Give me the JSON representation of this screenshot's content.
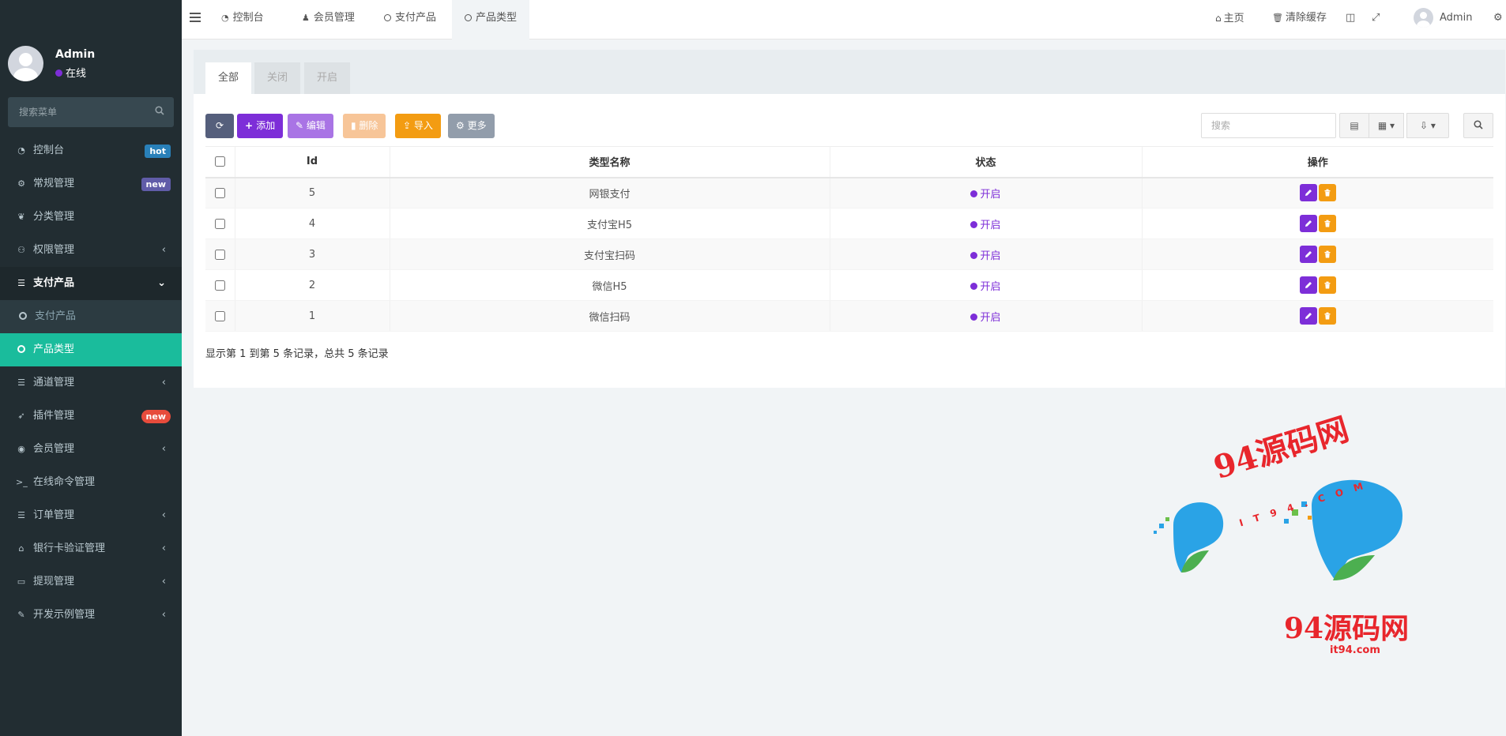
{
  "user": {
    "name": "Admin",
    "status": "在线"
  },
  "sidebar": {
    "search_placeholder": "搜索菜单",
    "items": [
      {
        "label": "控制台",
        "icon": "dashboard-icon",
        "badge": "hot"
      },
      {
        "label": "常规管理",
        "icon": "cogs-icon",
        "badge": "new"
      },
      {
        "label": "分类管理",
        "icon": "leaf-icon"
      },
      {
        "label": "权限管理",
        "icon": "group-icon",
        "arrow": "‹"
      },
      {
        "label": "支付产品",
        "icon": "list-icon",
        "arrow": "⌄"
      },
      {
        "label": "支付产品",
        "icon": "circle-icon"
      },
      {
        "label": "产品类型",
        "icon": "circle-icon"
      },
      {
        "label": "通道管理",
        "icon": "list-icon",
        "arrow": "‹"
      },
      {
        "label": "插件管理",
        "icon": "rocket-icon",
        "badge": "new"
      },
      {
        "label": "会员管理",
        "icon": "user-circle-icon",
        "arrow": "‹"
      },
      {
        "label": "在线命令管理",
        "icon": "terminal-icon"
      },
      {
        "label": "订单管理",
        "icon": "list-icon",
        "arrow": "‹"
      },
      {
        "label": "银行卡验证管理",
        "icon": "bank-icon",
        "arrow": "‹"
      },
      {
        "label": "提现管理",
        "icon": "visa-icon",
        "arrow": "‹"
      },
      {
        "label": "开发示例管理",
        "icon": "magic-icon",
        "arrow": "‹"
      }
    ]
  },
  "topnav": {
    "tabs": [
      {
        "label": "控制台",
        "icon": "dashboard-icon"
      },
      {
        "label": "会员管理",
        "icon": "user-icon"
      },
      {
        "label": "支付产品",
        "icon": "circle-icon"
      },
      {
        "label": "产品类型",
        "icon": "circle-icon"
      }
    ],
    "home": "主页",
    "clear_cache": "清除缓存",
    "admin": "Admin"
  },
  "panel": {
    "tabs": [
      "全部",
      "关闭",
      "开启"
    ],
    "toolbar": {
      "add": "添加",
      "edit": "编辑",
      "delete": "删除",
      "import": "导入",
      "more": "更多"
    },
    "search_placeholder": "搜索",
    "columns": [
      "Id",
      "类型名称",
      "状态",
      "操作"
    ],
    "rows": [
      {
        "id": "5",
        "name": "网银支付",
        "status": "开启"
      },
      {
        "id": "4",
        "name": "支付宝H5",
        "status": "开启"
      },
      {
        "id": "3",
        "name": "支付宝扫码",
        "status": "开启"
      },
      {
        "id": "2",
        "name": "微信H5",
        "status": "开启"
      },
      {
        "id": "1",
        "name": "微信扫码",
        "status": "开启"
      }
    ],
    "pagination_info": "显示第 1 到第 5 条记录，总共 5 条记录"
  },
  "watermark": {
    "text1": "94源码网",
    "sub": "IT94.COM",
    "text2": "94源码网",
    "text3": "it94.com"
  },
  "colors": {
    "sidebar_bg": "#222d32",
    "active_menu": "#1abc9c",
    "primary": "#7d2ed8",
    "warning": "#f39c12",
    "watermark": "#e8262c"
  }
}
